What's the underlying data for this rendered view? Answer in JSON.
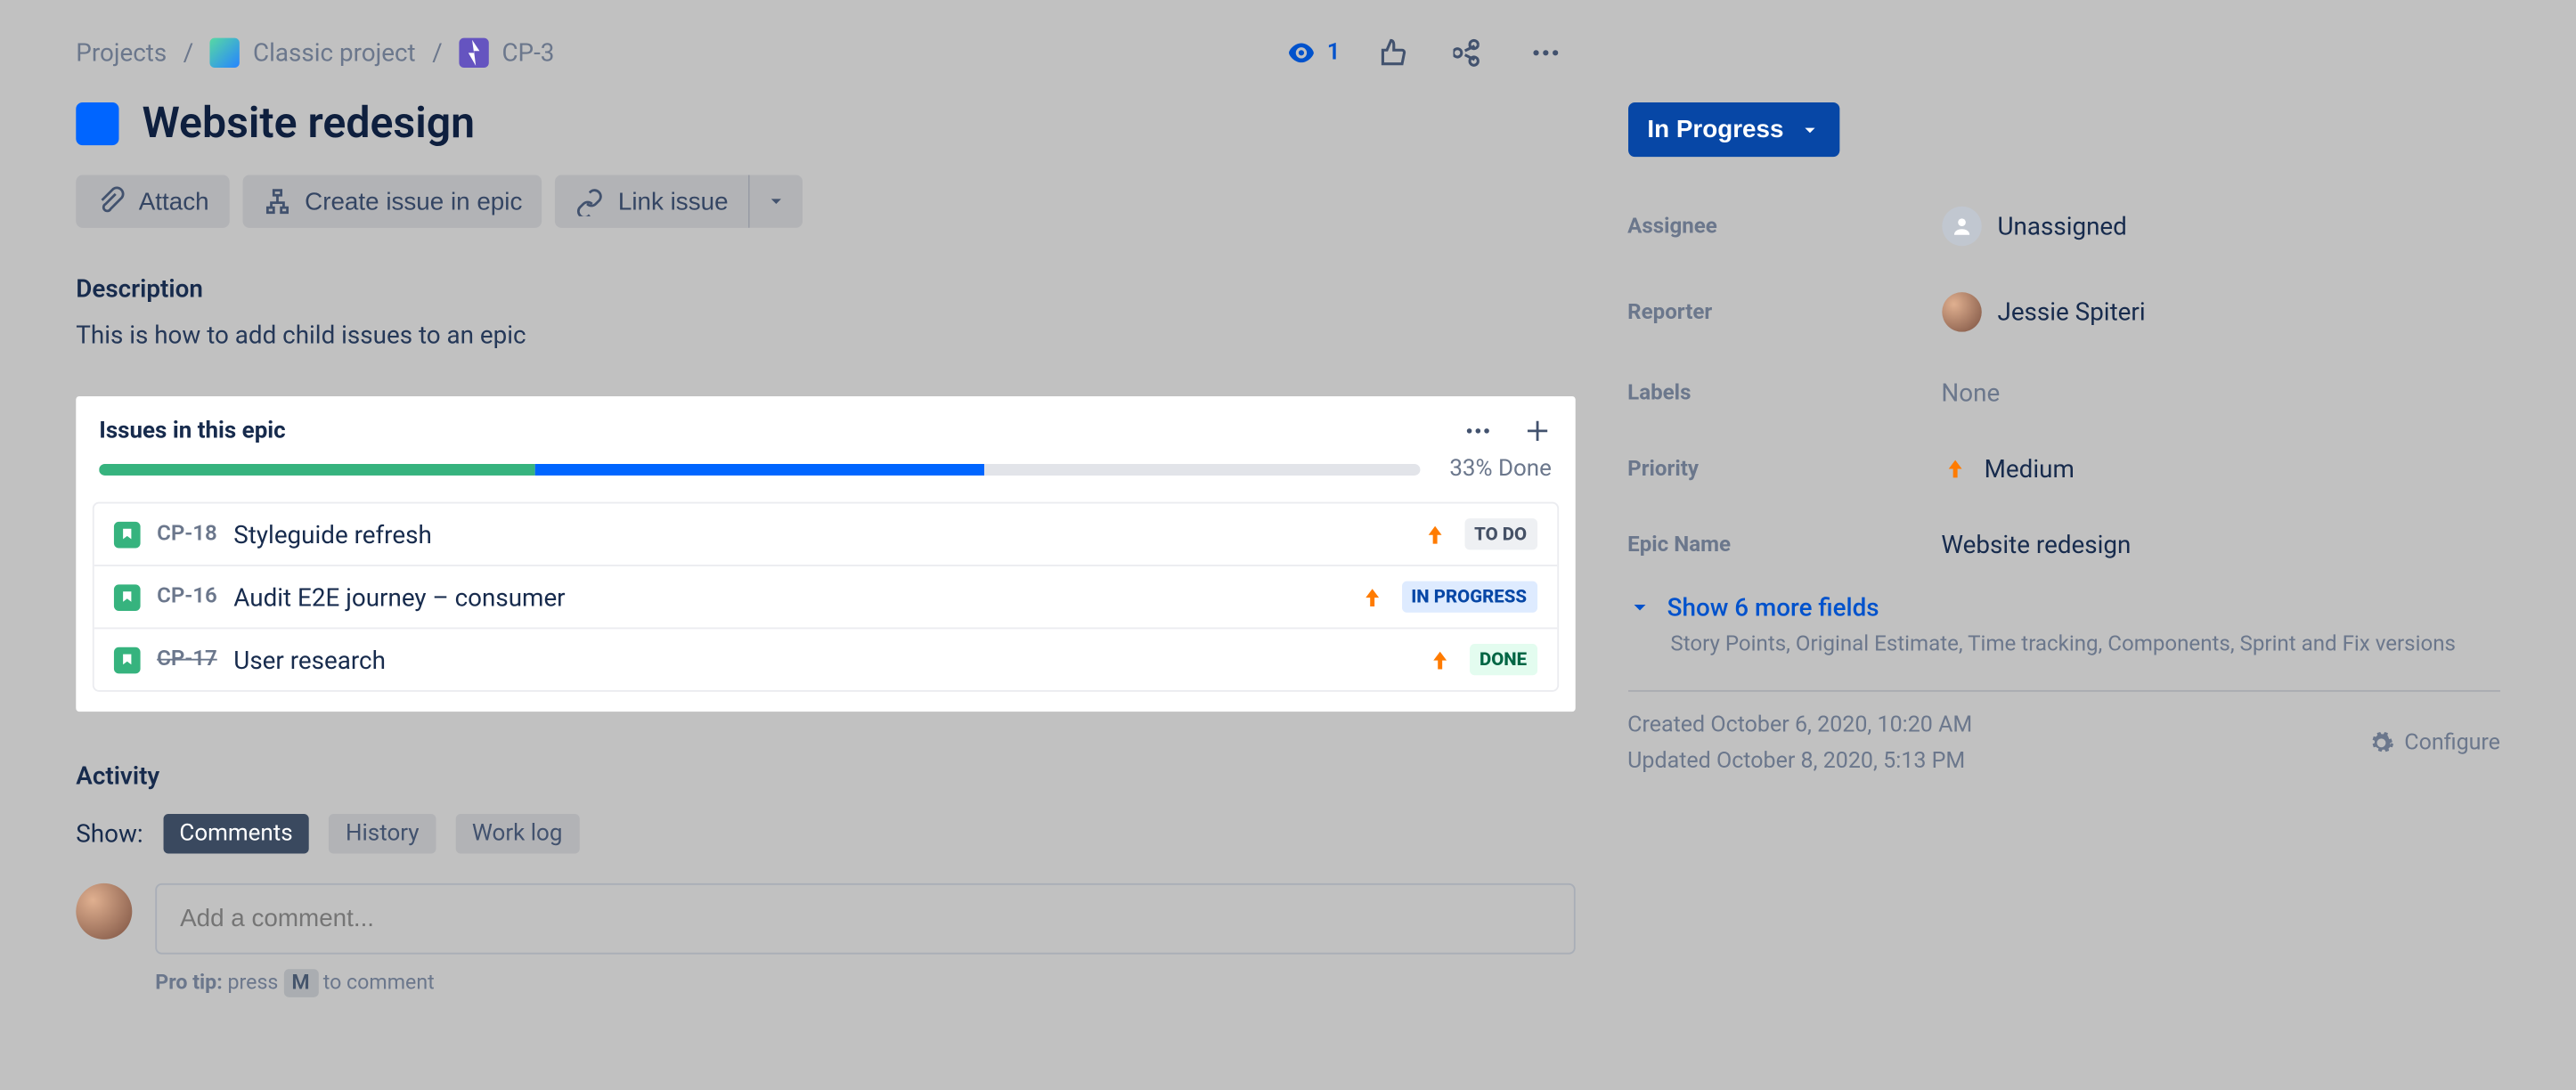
{
  "breadcrumbs": {
    "root": "Projects",
    "project": "Classic project",
    "key": "CP-3"
  },
  "watchers": "1",
  "title": "Website redesign",
  "actions": {
    "attach": "Attach",
    "create_child": "Create issue in epic",
    "link": "Link issue"
  },
  "description": {
    "heading": "Description",
    "body": "This is how to add child issues to an epic"
  },
  "issues_panel": {
    "heading": "Issues in this epic",
    "done_pct_label": "33% Done",
    "progress": {
      "green_pct": 33,
      "blue_pct": 34
    },
    "items": [
      {
        "key": "CP-18",
        "summary": "Styleguide refresh",
        "status": "TO DO",
        "status_class": "st-todo",
        "struck": false
      },
      {
        "key": "CP-16",
        "summary": "Audit E2E journey – consumer",
        "status": "IN PROGRESS",
        "status_class": "st-prog",
        "struck": false
      },
      {
        "key": "CP-17",
        "summary": "User research",
        "status": "DONE",
        "status_class": "st-done",
        "struck": true
      }
    ]
  },
  "activity": {
    "heading": "Activity",
    "show_label": "Show:",
    "tabs": {
      "comments": "Comments",
      "history": "History",
      "worklog": "Work log"
    },
    "comment_placeholder": "Add a comment...",
    "protip_prefix": "Pro tip:",
    "protip_press": "press",
    "protip_key": "M",
    "protip_suffix": "to comment"
  },
  "side": {
    "status": "In Progress",
    "fields": {
      "assignee_label": "Assignee",
      "assignee_value": "Unassigned",
      "reporter_label": "Reporter",
      "reporter_value": "Jessie Spiteri",
      "labels_label": "Labels",
      "labels_value": "None",
      "priority_label": "Priority",
      "priority_value": "Medium",
      "epic_name_label": "Epic Name",
      "epic_name_value": "Website redesign"
    },
    "show_more": "Show 6 more fields",
    "show_more_sub": "Story Points, Original Estimate, Time tracking, Components, Sprint and Fix versions",
    "created": "Created October 6, 2020, 10:20 AM",
    "updated": "Updated October 8, 2020, 5:13 PM",
    "configure": "Configure"
  }
}
